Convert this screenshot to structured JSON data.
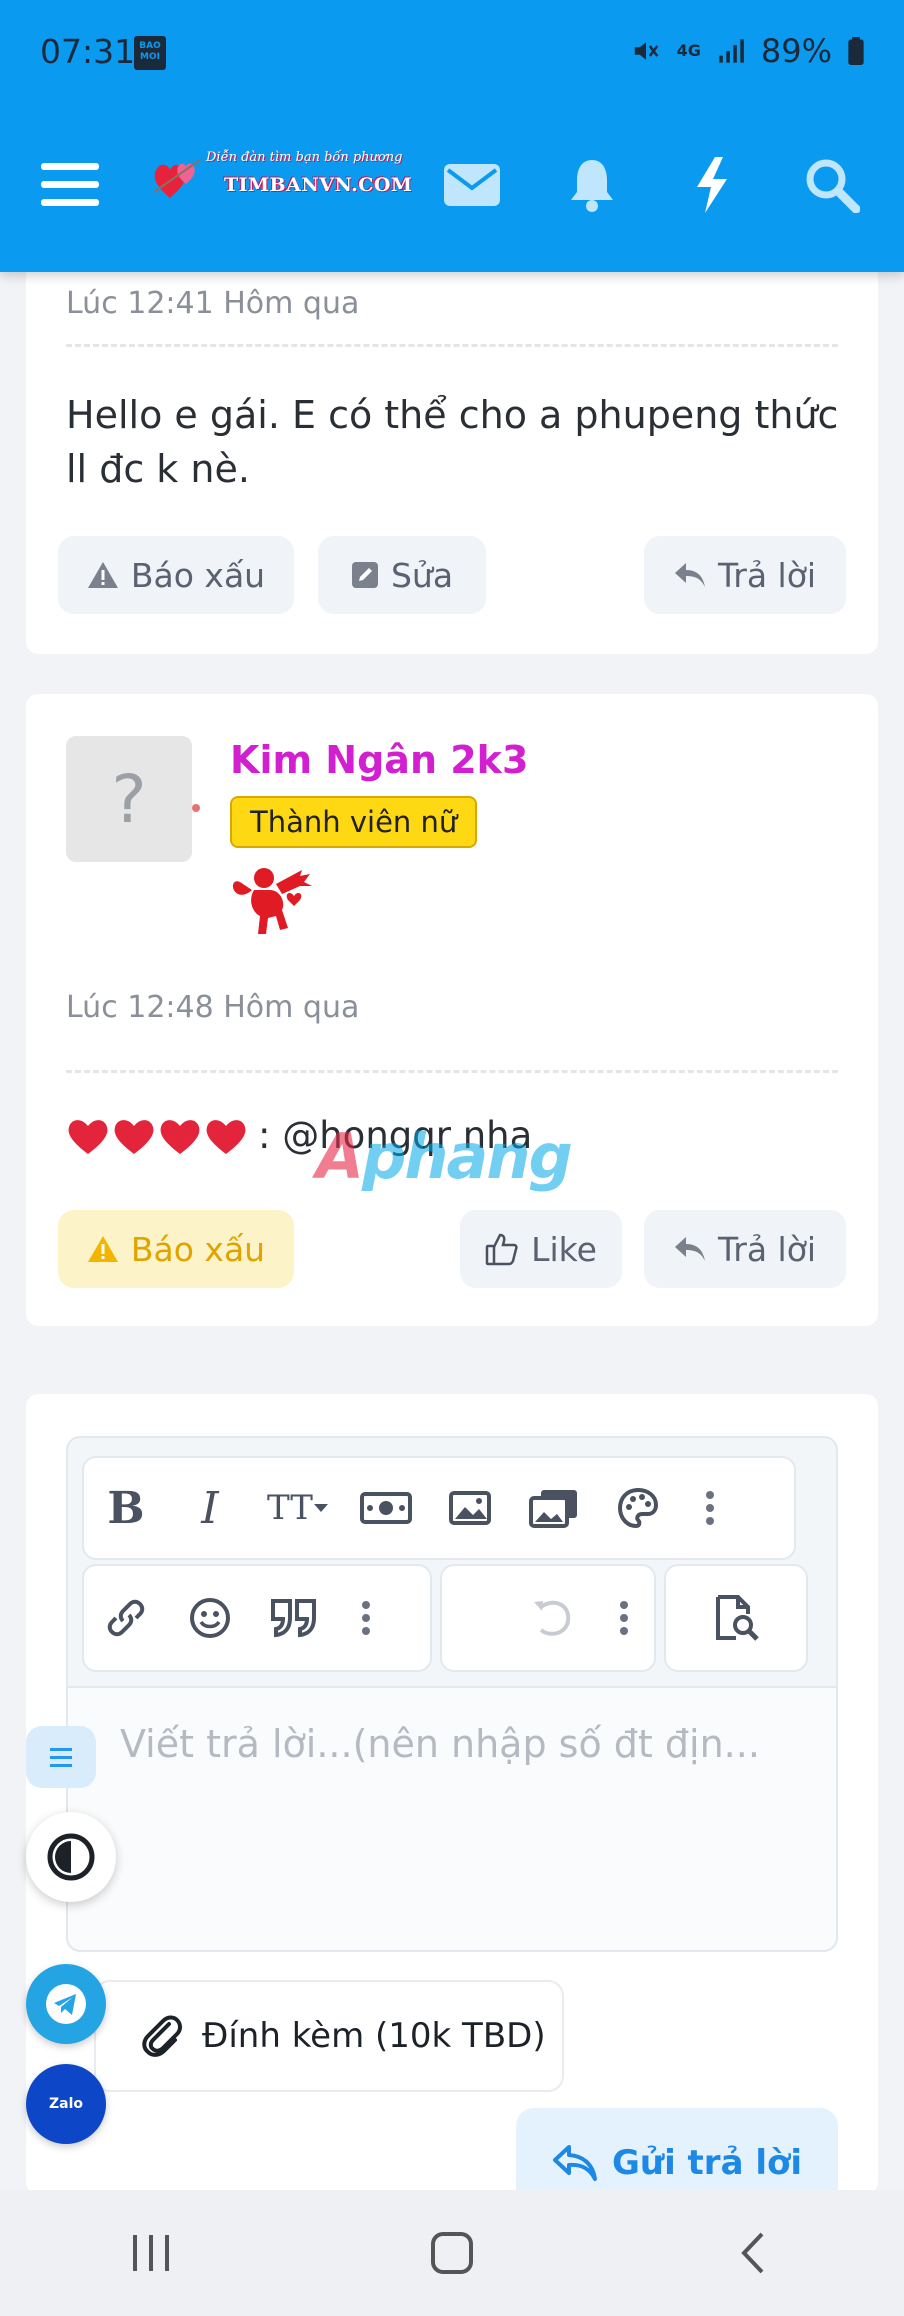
{
  "status_bar": {
    "time": "07:31",
    "app_badge": "BAO MOI",
    "network": "4G",
    "battery": "89%"
  },
  "header": {
    "logo_slogan": "Diễn đàn tìm bạn bốn phương",
    "logo_site": "TIMBANVN.COM",
    "color": "#0a9bf0"
  },
  "post1": {
    "time": "Lúc 12:41 Hôm qua",
    "message": "Hello e gái. E có thể cho a phupeng thức ll đc k nè.",
    "report_label": "Báo xấu",
    "edit_label": "Sửa",
    "reply_label": "Trả lời"
  },
  "post2": {
    "avatar_text": "?",
    "username": "Kim Ngân 2k3",
    "badge": "Thành viên nữ",
    "time": "Lúc 12:48 Hôm qua",
    "mention": ": @hongqr nha",
    "report_label": "Báo xấu",
    "like_label": "Like",
    "reply_label": "Trả lời",
    "username_color": "#d21fcf"
  },
  "watermark": {
    "part1": "A",
    "part2": "phang"
  },
  "editor": {
    "toolbar_text_size": "TT",
    "placeholder": "Viết trả lời...(nên nhập số đt địn..."
  },
  "attach_label": "Đính kèm (10k TBD)",
  "send_label": "Gửi trả lời",
  "floating": {
    "zalo_label": "Zalo"
  }
}
